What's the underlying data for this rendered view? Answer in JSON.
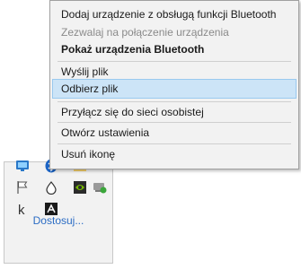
{
  "context_menu": {
    "items": [
      {
        "label": "Dodaj urządzenie z obsługą funkcji Bluetooth",
        "state": "normal"
      },
      {
        "label": "Zezwalaj na połączenie urządzenia",
        "state": "disabled"
      },
      {
        "label": "Pokaż urządzenia Bluetooth",
        "state": "bold"
      },
      {
        "label": "Wyślij plik",
        "state": "normal"
      },
      {
        "label": "Odbierz plik",
        "state": "highlighted"
      },
      {
        "label": "Przyłącz się do sieci osobistej",
        "state": "normal"
      },
      {
        "label": "Otwórz ustawienia",
        "state": "normal"
      },
      {
        "label": "Usuń ikonę",
        "state": "normal"
      }
    ]
  },
  "tray": {
    "customize_label": "Dostosuj...",
    "icons": [
      "monitor-icon",
      "bluetooth-icon",
      "folder-icon",
      "flag-icon",
      "water-drop-icon",
      "nvidia-icon",
      "network-icon",
      "k-app-icon",
      "adobe-icon"
    ]
  },
  "colors": {
    "highlight_bg": "#cce4f7",
    "highlight_border": "#99c9ef",
    "link": "#2b6cc4",
    "bluetooth": "#1c64c4"
  }
}
